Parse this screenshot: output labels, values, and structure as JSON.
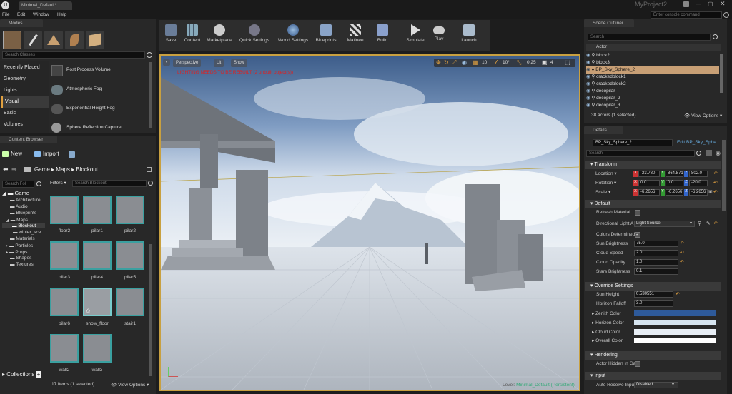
{
  "titlebar": {
    "tab": "Minimal_Default*",
    "project": "MyProject2",
    "console_placeholder": "Enter console command"
  },
  "menu": [
    "File",
    "Edit",
    "Window",
    "Help"
  ],
  "modes": {
    "tab": "Modes",
    "search_placeholder": "Search Classes",
    "categories": [
      "Recently Placed",
      "Geometry",
      "Lights",
      "Visual",
      "Basic",
      "Volumes"
    ],
    "selected_category": "Visual",
    "items": [
      "Post Process Volume",
      "Atmospheric Fog",
      "Exponential Height Fog",
      "Sphere Reflection Capture"
    ]
  },
  "content_browser": {
    "tab": "Content Browser",
    "new_label": "New",
    "import_label": "Import",
    "path": [
      "Game",
      "Maps",
      "Blockout"
    ],
    "folder_search_placeholder": "Search Fol",
    "filters_label": "Filters",
    "search_placeholder": "Search Blockout",
    "tree": [
      "Game",
      "Architecture",
      "Audio",
      "Blueprints",
      "Maps",
      "Blockout",
      "winter_sce",
      "Materials",
      "Particles",
      "Props",
      "Shapes",
      "Textures"
    ],
    "assets": [
      "floor2",
      "pilar1",
      "pilar2",
      "pilar3",
      "pilar4",
      "pilar5",
      "pilar6",
      "snow_floor",
      "stair1",
      "wall2",
      "wall3"
    ],
    "status": "17 items (1 selected)",
    "view_options": "View Options",
    "collections_label": "Collections"
  },
  "toolbar": [
    "Save",
    "Content",
    "Marketplace",
    "Quick Settings",
    "World Settings",
    "Blueprints",
    "Matinee",
    "Build",
    "Simulate",
    "Play",
    "Launch"
  ],
  "viewport": {
    "perspective": "Perspective",
    "lit": "Lit",
    "show": "Show",
    "warning": "LIGHTING NEEDS TO BE REBUILT (2 unbuilt object(s))",
    "grid_snap": "10",
    "rot_snap": "10°",
    "scale_snap": "0.25",
    "cam_speed": "4",
    "level_label": "Level:",
    "level_name": "Minimal_Default (Persistent)"
  },
  "outliner": {
    "tab": "Scene Outliner",
    "search_placeholder": "Search",
    "column": "Actor",
    "rows": [
      "block2",
      "block3",
      "BP_Sky_Sphere_2",
      "crackedblock1",
      "crackedblock2",
      "decopilar",
      "decopilar_2",
      "decopilar_3"
    ],
    "selected": "BP_Sky_Sphere_2",
    "status": "38 actors (1 selected)",
    "view_options": "View Options"
  },
  "details": {
    "tab": "Details",
    "object": "BP_Sky_Sphere_2",
    "edit_link": "Edit BP_Sky_Sphe",
    "search_placeholder": "Search",
    "transform": {
      "title": "Transform",
      "location_label": "Location",
      "location": [
        "-23.780",
        "864.871",
        "802.0"
      ],
      "rotation_label": "Rotation",
      "rotation": [
        "0.0",
        "0.0",
        "-20.0"
      ],
      "scale_label": "Scale",
      "scale": [
        "-6.2656",
        "-6.2656",
        "-6.2656"
      ]
    },
    "default": {
      "title": "Default",
      "refresh_label": "Refresh Material",
      "dir_light_label": "Directional Light A",
      "dir_light_value": "Light Source",
      "colors_determined_label": "Colors Determined",
      "sun_brightness_label": "Sun Brightness",
      "sun_brightness": "75.0",
      "cloud_speed_label": "Cloud Speed",
      "cloud_speed": "2.0",
      "cloud_opacity_label": "Cloud Opacity",
      "cloud_opacity": "1.0",
      "stars_brightness_label": "Stars Brightness",
      "stars_brightness": "0.1"
    },
    "override": {
      "title": "Override Settings",
      "sun_height_label": "Sun Height",
      "sun_height": "0.530551",
      "horizon_falloff_label": "Horizon Falloff",
      "horizon_falloff": "3.0",
      "zenith_label": "Zenith Color",
      "horizon_label": "Horizon Color",
      "cloud_color_label": "Cloud Color",
      "overall_label": "Overall Color"
    },
    "rendering": {
      "title": "Rendering",
      "hidden_label": "Actor Hidden In Ga"
    },
    "input": {
      "title": "Input",
      "auto_receive_label": "Auto Receive Input",
      "auto_receive_value": "Disabled"
    }
  },
  "colors": {
    "accent_orange": "#e0a040",
    "selected_row": "#c89f75",
    "zenith": "#2e5a9a",
    "horizon": "#d6e4f0",
    "cloud": "#e8eef5",
    "overall": "#ffffff",
    "tile_border": "#3aa0a0"
  }
}
